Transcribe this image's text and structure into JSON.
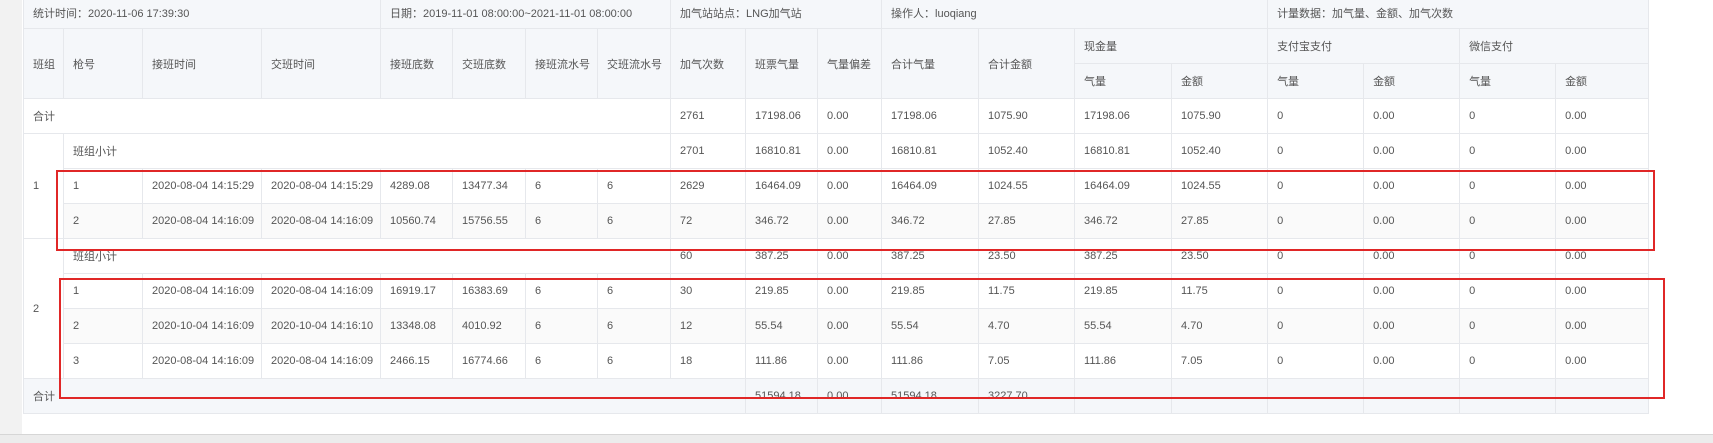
{
  "info": {
    "stat_time": "统计时间：2020-11-06 17:39:30",
    "date_range": "日期：2019-11-01 08:00:00~2021-11-01 08:00:00",
    "station": "加气站站点：LNG加气站",
    "operator": "操作人：luoqiang",
    "metrics": "计量数据：加气量、金额、加气次数"
  },
  "columns": {
    "team": "班组",
    "gun": "枪号",
    "start_time": "接班时间",
    "end_time": "交班时间",
    "start_reading": "接班底数",
    "end_reading": "交班底数",
    "start_serial": "接班流水号",
    "end_serial": "交班流水号",
    "fill_count": "加气次数",
    "shift_gas": "班票气量",
    "gas_diff": "气量偏差",
    "total_gas": "合计气量",
    "total_amount": "合计金额",
    "cash": "现金量",
    "alipay": "支付宝支付",
    "wechat": "微信支付",
    "sub_gas": "气量",
    "sub_amount": "金额"
  },
  "total_row": {
    "label": "合计",
    "fill_count": "2761",
    "shift_gas": "17198.06",
    "gas_diff": "0.00",
    "total_gas": "17198.06",
    "total_amount": "1075.90",
    "cash_gas": "17198.06",
    "cash_amount": "1075.90",
    "ali_gas": "0",
    "ali_amount": "0.00",
    "wx_gas": "0",
    "wx_amount": "0.00"
  },
  "teams": [
    {
      "team": "1",
      "subtotal": {
        "label": "班组小计",
        "fill_count": "2701",
        "shift_gas": "16810.81",
        "gas_diff": "0.00",
        "total_gas": "16810.81",
        "total_amount": "1052.40",
        "cash_gas": "16810.81",
        "cash_amount": "1052.40",
        "ali_gas": "0",
        "ali_amount": "0.00",
        "wx_gas": "0",
        "wx_amount": "0.00"
      },
      "rows": [
        {
          "gun": "1",
          "start_time": "2020-08-04 14:15:29",
          "end_time": "2020-08-04 14:15:29",
          "start_reading": "4289.08",
          "end_reading": "13477.34",
          "start_serial": "6",
          "end_serial": "6",
          "fill_count": "2629",
          "shift_gas": "16464.09",
          "gas_diff": "0.00",
          "total_gas": "16464.09",
          "total_amount": "1024.55",
          "cash_gas": "16464.09",
          "cash_amount": "1024.55",
          "ali_gas": "0",
          "ali_amount": "0.00",
          "wx_gas": "0",
          "wx_amount": "0.00"
        },
        {
          "gun": "2",
          "start_time": "2020-08-04 14:16:09",
          "end_time": "2020-08-04 14:16:09",
          "start_reading": "10560.74",
          "end_reading": "15756.55",
          "start_serial": "6",
          "end_serial": "6",
          "fill_count": "72",
          "shift_gas": "346.72",
          "gas_diff": "0.00",
          "total_gas": "346.72",
          "total_amount": "27.85",
          "cash_gas": "346.72",
          "cash_amount": "27.85",
          "ali_gas": "0",
          "ali_amount": "0.00",
          "wx_gas": "0",
          "wx_amount": "0.00"
        }
      ]
    },
    {
      "team": "2",
      "subtotal": {
        "label": "班组小计",
        "fill_count": "60",
        "shift_gas": "387.25",
        "gas_diff": "0.00",
        "total_gas": "387.25",
        "total_amount": "23.50",
        "cash_gas": "387.25",
        "cash_amount": "23.50",
        "ali_gas": "0",
        "ali_amount": "0.00",
        "wx_gas": "0",
        "wx_amount": "0.00"
      },
      "rows": [
        {
          "gun": "1",
          "start_time": "2020-08-04 14:16:09",
          "end_time": "2020-08-04 14:16:09",
          "start_reading": "16919.17",
          "end_reading": "16383.69",
          "start_serial": "6",
          "end_serial": "6",
          "fill_count": "30",
          "shift_gas": "219.85",
          "gas_diff": "0.00",
          "total_gas": "219.85",
          "total_amount": "11.75",
          "cash_gas": "219.85",
          "cash_amount": "11.75",
          "ali_gas": "0",
          "ali_amount": "0.00",
          "wx_gas": "0",
          "wx_amount": "0.00"
        },
        {
          "gun": "2",
          "start_time": "2020-10-04 14:16:09",
          "end_time": "2020-10-04 14:16:10",
          "start_reading": "13348.08",
          "end_reading": "4010.92",
          "start_serial": "6",
          "end_serial": "6",
          "fill_count": "12",
          "shift_gas": "55.54",
          "gas_diff": "0.00",
          "total_gas": "55.54",
          "total_amount": "4.70",
          "cash_gas": "55.54",
          "cash_amount": "4.70",
          "ali_gas": "0",
          "ali_amount": "0.00",
          "wx_gas": "0",
          "wx_amount": "0.00"
        },
        {
          "gun": "3",
          "start_time": "2020-08-04 14:16:09",
          "end_time": "2020-08-04 14:16:09",
          "start_reading": "2466.15",
          "end_reading": "16774.66",
          "start_serial": "6",
          "end_serial": "6",
          "fill_count": "18",
          "shift_gas": "111.86",
          "gas_diff": "0.00",
          "total_gas": "111.86",
          "total_amount": "7.05",
          "cash_gas": "111.86",
          "cash_amount": "7.05",
          "ali_gas": "0",
          "ali_amount": "0.00",
          "wx_gas": "0",
          "wx_amount": "0.00"
        }
      ]
    }
  ],
  "grand_total_row": {
    "label": "合计",
    "shift_gas": "51594.18",
    "gas_diff": "0.00",
    "total_gas": "51594.18",
    "total_amount": "3227.70"
  },
  "colors": {
    "highlight": "#e02727",
    "header_bg": "#f5f7fa",
    "border": "#e6e8ec"
  }
}
